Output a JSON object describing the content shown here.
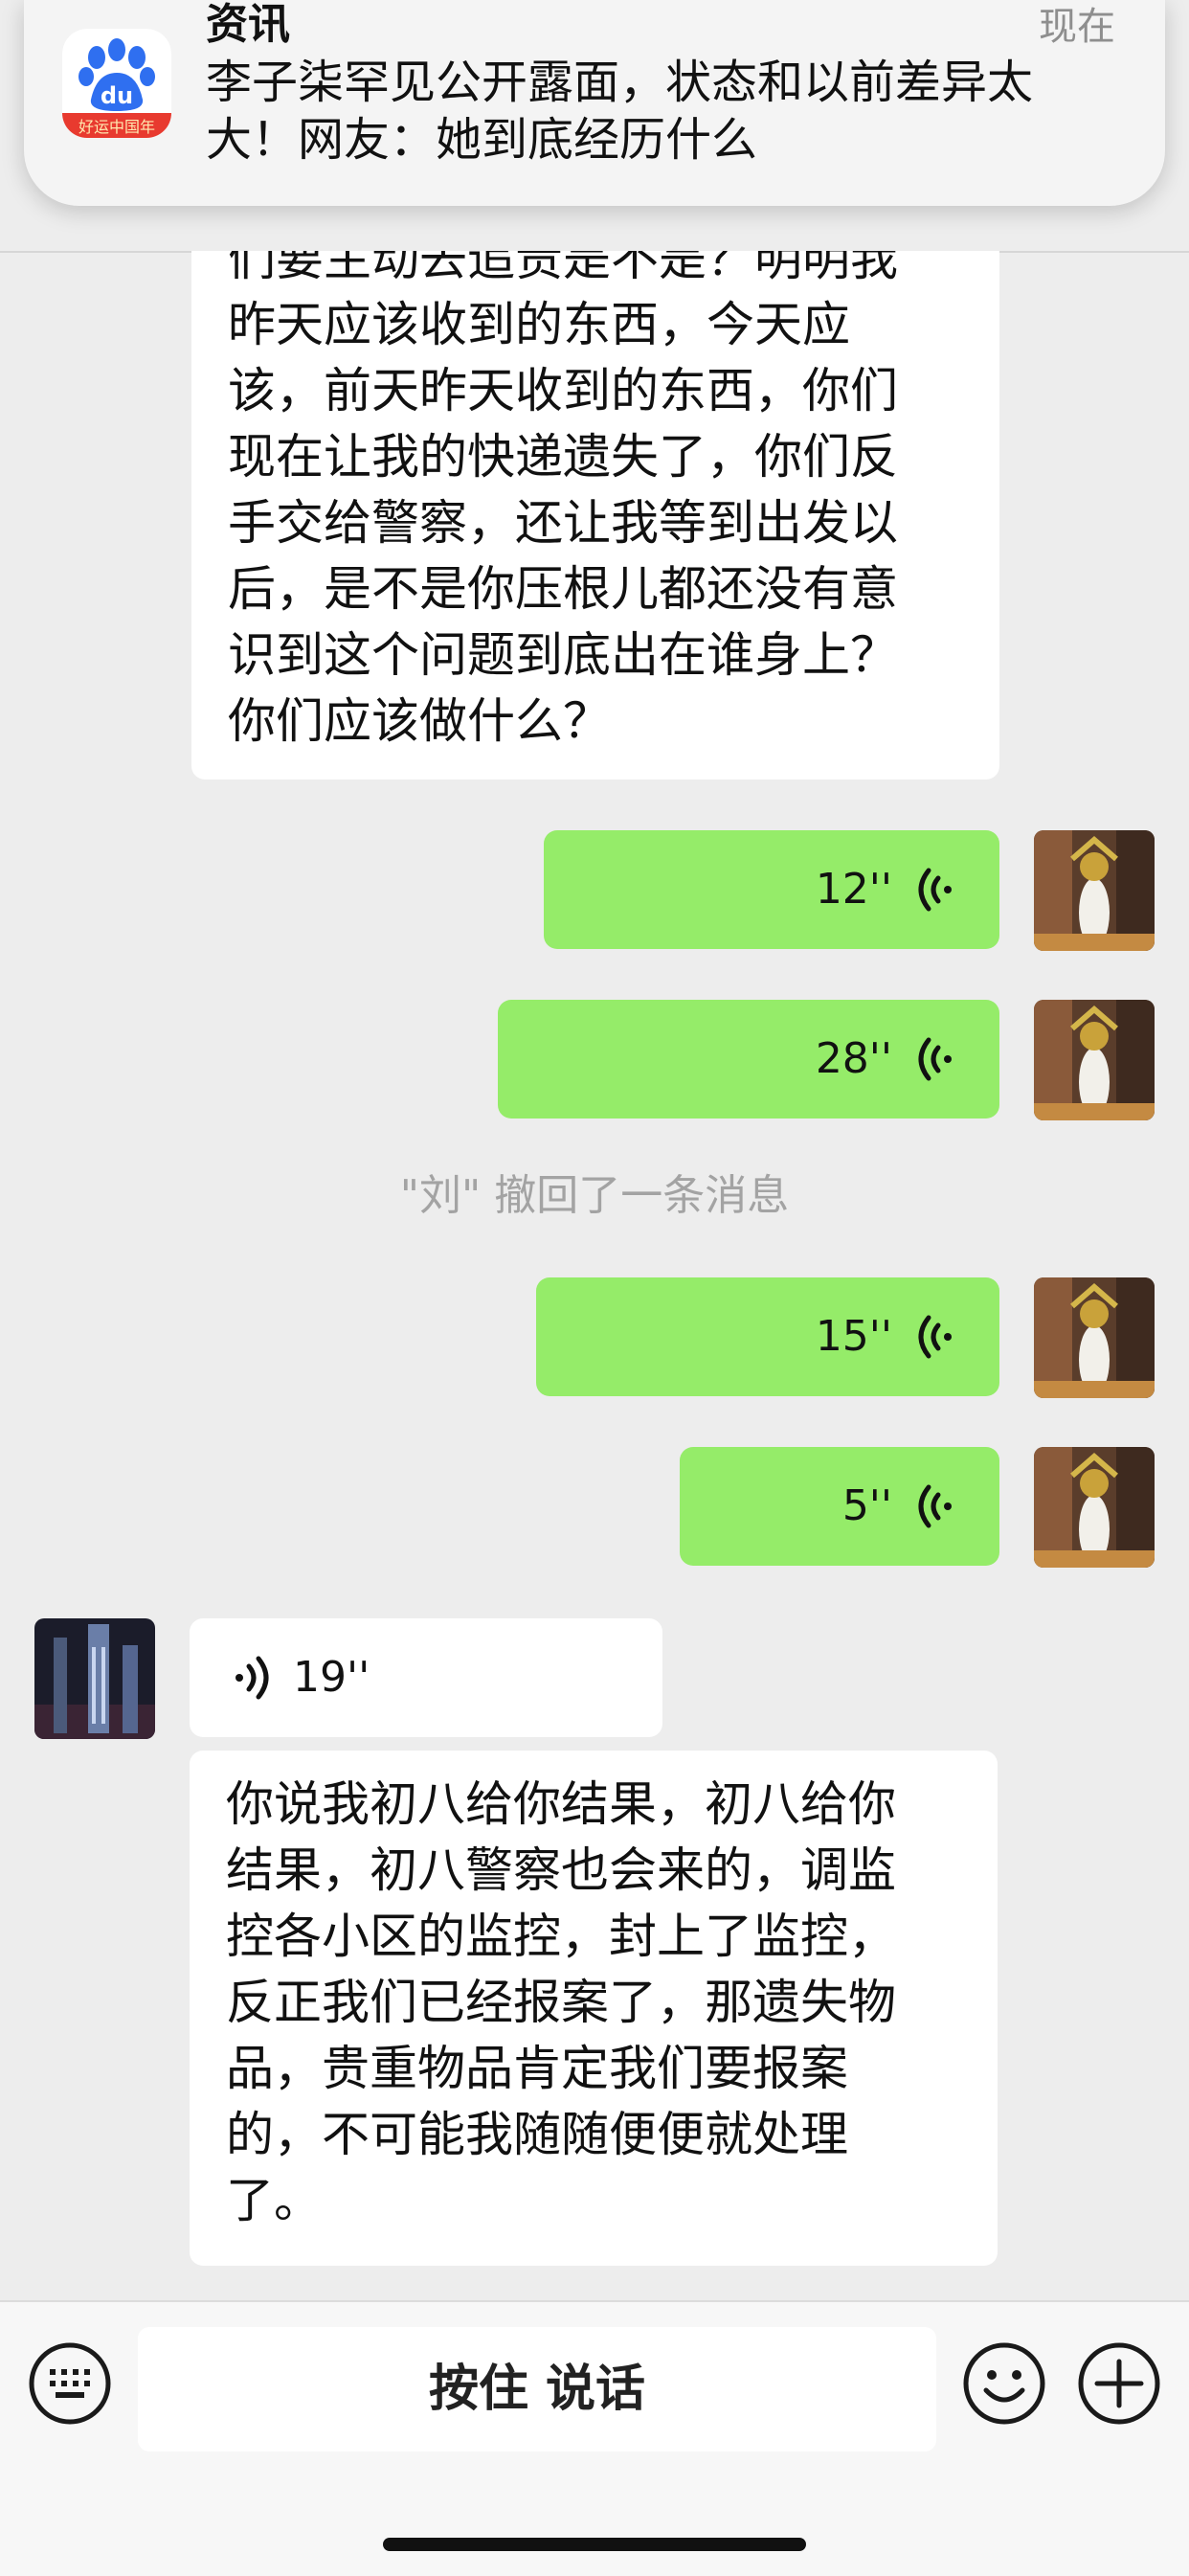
{
  "notification": {
    "app": "资讯",
    "time": "现在",
    "lines": [
      "李子柒罕见公开露面，状态和以前差异太",
      "大！网友：她到底经历什么"
    ],
    "icon": "baidu-app-icon",
    "icon_caption": "好运中国年"
  },
  "chat": {
    "incoming_text_1": [
      "们要主动去追责是不是？明明我",
      "昨天应该收到的东西，今天应",
      "该，前天昨天收到的东西，你们",
      "现在让我的快递遗失了，你们反",
      "手交给警察，还让我等到出发以",
      "后，是不是你压根儿都还没有意",
      "识到这个问题到底出在谁身上？",
      "你们应该做什么？"
    ],
    "outgoing_voice": [
      "12''",
      "28''"
    ],
    "system_notice": "\"刘\" 撤回了一条消息",
    "outgoing_voice_2": [
      "15''",
      "5''"
    ],
    "incoming_voice": "19''",
    "incoming_text_2": [
      "你说我初八给你结果，初八给你",
      "结果，初八警察也会来的，调监",
      "控各小区的监控，封上了监控，",
      "反正我们已经报案了，那遗失物",
      "品，贵重物品肯定我们要报案",
      "的，不可能我随随便便就处理",
      "了。"
    ]
  },
  "input_bar": {
    "hold_to_talk": "按住 说话",
    "icons": [
      "keyboard-icon",
      "emoji-icon",
      "plus-icon"
    ]
  },
  "colors": {
    "background": "#ededed",
    "outgoing_bubble": "#95ec69",
    "incoming_bubble": "#ffffff",
    "system_text": "#a3a3a3"
  }
}
